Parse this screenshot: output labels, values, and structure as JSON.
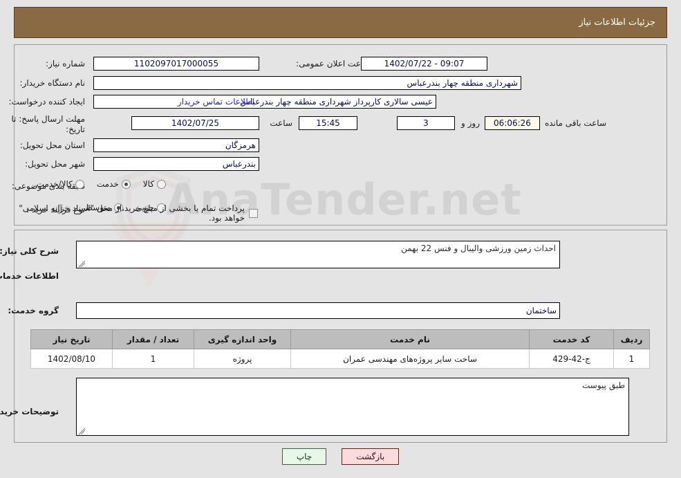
{
  "header": {
    "title": "جزئیات اطلاعات نیاز"
  },
  "colors": {
    "header_bg": "#8a6a42",
    "page_bg": "#e4e4e4",
    "link": "#1a1ae0",
    "input_text": "#0a0a5a",
    "table_header_bg": "#bdbdbd",
    "print_button_bg": "#e8f7e8",
    "back_button_bg": "#fadcdc",
    "countdown_bg": "#fbfbe8"
  },
  "watermark": {
    "text": "AnaTender.net"
  },
  "top_panel": {
    "need_number": {
      "label": "شماره نیاز:",
      "value": "1102097017000055"
    },
    "buyer_org": {
      "label": "نام دستگاه خریدار:",
      "value": "شهرداری منطقه چهار بندرعباس"
    },
    "requester": {
      "label": "ایجاد کننده درخواست:",
      "value": "عیسی سالاری کارپرداز شهرداری منطقه چهار بندرعباس"
    },
    "announce_datetime": {
      "label": "تاریخ و ساعت اعلان عمومی:",
      "value": "09:07 - 1402/07/22"
    },
    "buyer_contact_link": "اطلاعات تماس خریدار",
    "deadline": {
      "label": "مهلت ارسال پاسخ: تا تاریخ:",
      "date": "1402/07/25",
      "time_label": "ساعت",
      "time": "15:45",
      "days": "3",
      "days_label": "روز و",
      "countdown": "06:06:26",
      "countdown_label": "ساعت باقی مانده"
    },
    "delivery_province": {
      "label": "استان محل تحویل:",
      "value": "هرمزگان"
    },
    "delivery_city": {
      "label": "شهر محل تحویل:",
      "value": "بندرعباس"
    },
    "category": {
      "label": "طبقه بندی موضوعی:",
      "options": [
        {
          "text": "کالا",
          "selected": false
        },
        {
          "text": "خدمت",
          "selected": true
        },
        {
          "text": "کالا/خدمت",
          "selected": false
        }
      ]
    },
    "purchase_process": {
      "label": "نوع فرآیند خرید :",
      "options": [
        {
          "text": "جزیی",
          "selected": false
        },
        {
          "text": "متوسط",
          "selected": true
        }
      ],
      "checkbox_checked": false,
      "checkbox_text": "پرداخت تمام یا بخشی از مبلغ خرید،از محل \"اسناد خزانه اسلامی\" خواهد بود."
    }
  },
  "mid_panel": {
    "need_summary": {
      "label": "شرح کلی نیاز:",
      "value": "احداث زمین ورزشی والیبال و فنس 22 بهمن"
    },
    "services_section_title": "اطلاعات خدمات مورد نیاز",
    "service_group": {
      "label": "گروه خدمت:",
      "value": "ساختمان"
    },
    "table": {
      "headers": [
        "ردیف",
        "کد خدمت",
        "نام خدمت",
        "واحد اندازه گیری",
        "تعداد / مقدار",
        "تاریخ نیاز"
      ],
      "rows": [
        [
          "1",
          "ج-42-429",
          "ساخت سایر پروژه‌های مهندسی عمران",
          "پروژه",
          "1",
          "1402/08/10"
        ]
      ]
    },
    "buyer_notes": {
      "label": "توضیحات خریدار:",
      "value": "طبق پیوست"
    }
  },
  "buttons": {
    "print": "چاپ",
    "back": "بازگشت"
  }
}
